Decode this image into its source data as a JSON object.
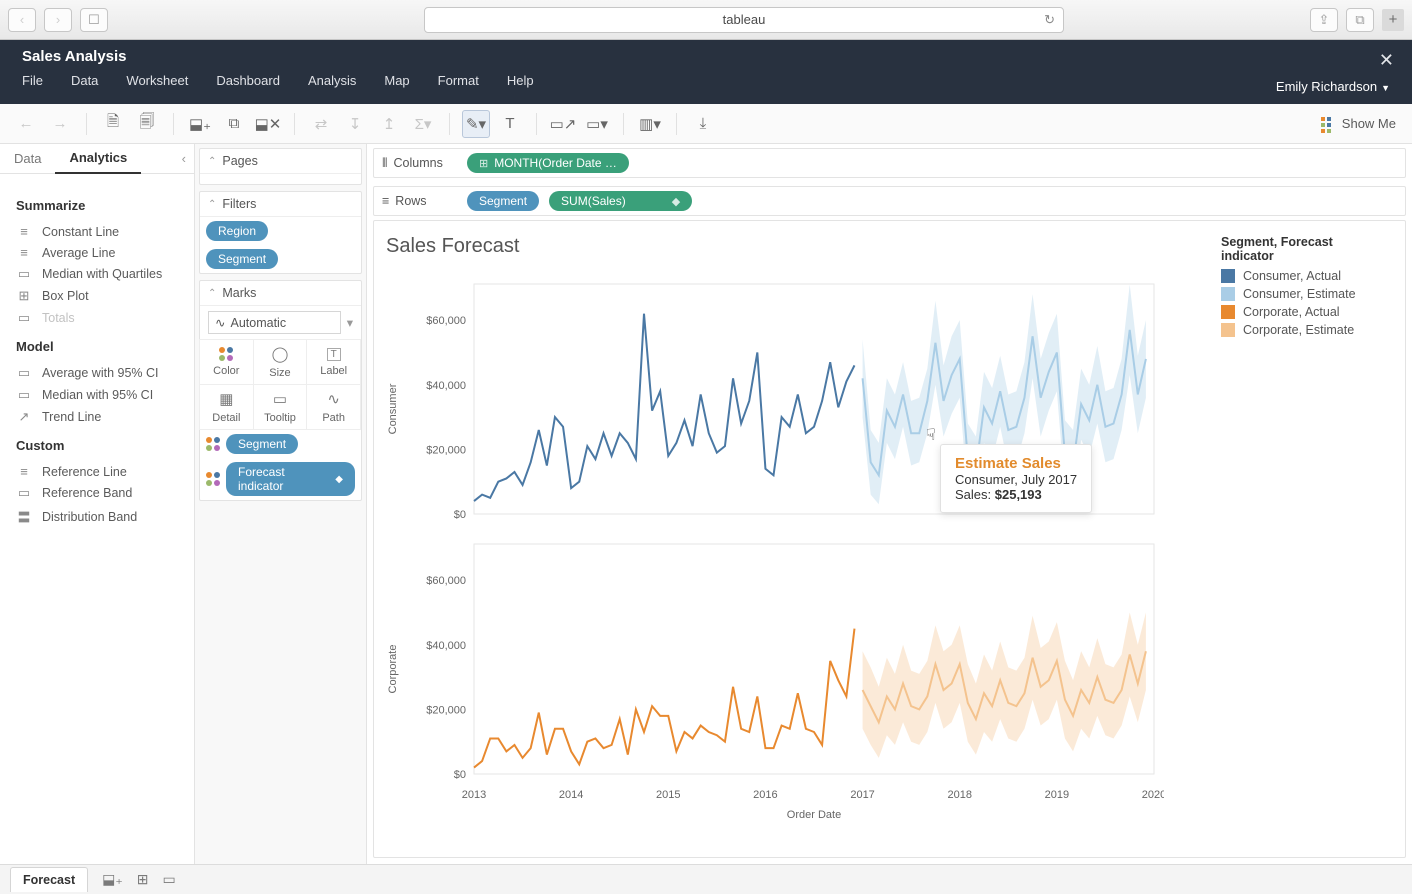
{
  "browser": {
    "url_label": "tableau"
  },
  "app": {
    "title": "Sales Analysis",
    "menus": [
      "File",
      "Data",
      "Worksheet",
      "Dashboard",
      "Analysis",
      "Map",
      "Format",
      "Help"
    ],
    "user": "Emily Richardson"
  },
  "toolbar": {
    "showme": "Show Me"
  },
  "left_panel": {
    "tabs": [
      "Data",
      "Analytics"
    ],
    "active_tab": "Analytics",
    "sections": {
      "summarize": {
        "title": "Summarize",
        "items": [
          "Constant Line",
          "Average Line",
          "Median with Quartiles",
          "Box Plot",
          "Totals"
        ],
        "disabled": [
          "Totals"
        ]
      },
      "model": {
        "title": "Model",
        "items": [
          "Average with 95% CI",
          "Median with 95% CI",
          "Trend Line"
        ]
      },
      "custom": {
        "title": "Custom",
        "items": [
          "Reference Line",
          "Reference Band",
          "Distribution Band"
        ]
      }
    }
  },
  "cards": {
    "pages": "Pages",
    "filters": {
      "title": "Filters",
      "pills": [
        "Region",
        "Segment"
      ]
    },
    "marks": {
      "title": "Marks",
      "type": "Automatic",
      "cells": [
        "Color",
        "Size",
        "Label",
        "Detail",
        "Tooltip",
        "Path"
      ],
      "encodings": [
        {
          "label": "Segment",
          "icon": "color"
        },
        {
          "label": "Forecast indicator",
          "icon": "color",
          "badge": true
        }
      ]
    }
  },
  "shelves": {
    "columns": {
      "label": "Columns",
      "chips": [
        {
          "text": "MONTH(Order Date …",
          "kind": "green"
        }
      ]
    },
    "rows": {
      "label": "Rows",
      "chips": [
        {
          "text": "Segment",
          "kind": "blue"
        },
        {
          "text": "SUM(Sales)",
          "kind": "green",
          "badge": true
        }
      ]
    }
  },
  "viz": {
    "title": "Sales Forecast",
    "x_label": "Order Date",
    "rows": [
      "Consumer",
      "Corporate"
    ],
    "y_ticks": [
      "$0",
      "$20,000",
      "$40,000",
      "$60,000"
    ],
    "x_ticks": [
      "2013",
      "2014",
      "2015",
      "2016",
      "2017",
      "2018",
      "2019",
      "2020"
    ],
    "legend": {
      "title": "Segment, Forecast indicator",
      "items": [
        {
          "label": "Consumer, Actual",
          "color": "#4a78a4"
        },
        {
          "label": "Consumer, Estimate",
          "color": "#a9cde6"
        },
        {
          "label": "Corporate, Actual",
          "color": "#e8892f"
        },
        {
          "label": "Corporate, Estimate",
          "color": "#f4c38e"
        }
      ]
    },
    "tooltip": {
      "title": "Estimate Sales",
      "line2": "Consumer, July 2017",
      "line3_label": "Sales: ",
      "line3_value": "$25,193"
    }
  },
  "bottom": {
    "sheet": "Forecast"
  },
  "chart_data": [
    {
      "type": "line",
      "title": "Sales Forecast",
      "panel": "Consumer",
      "xlabel": "Order Date",
      "ylabel": "Consumer",
      "ylim": [
        0,
        65000
      ],
      "x_years": [
        2013,
        2014,
        2015,
        2016,
        2017,
        2018,
        2019,
        2020
      ],
      "series": [
        {
          "name": "Consumer, Actual",
          "color": "#4a78a4",
          "x_months": [
            0,
            1,
            2,
            3,
            4,
            5,
            6,
            7,
            8,
            9,
            10,
            11,
            12,
            13,
            14,
            15,
            16,
            17,
            18,
            19,
            20,
            21,
            22,
            23,
            24,
            25,
            26,
            27,
            28,
            29,
            30,
            31,
            32,
            33,
            34,
            35,
            36,
            37,
            38,
            39,
            40,
            41,
            42,
            43,
            44,
            45,
            46,
            47
          ],
          "values": [
            4000,
            6000,
            5000,
            10000,
            11000,
            13000,
            9000,
            16000,
            26000,
            15000,
            30000,
            27000,
            8000,
            10000,
            21000,
            17000,
            25000,
            18000,
            25000,
            22000,
            17000,
            62000,
            32000,
            38000,
            18000,
            22000,
            29000,
            21000,
            37000,
            25000,
            19000,
            21000,
            42000,
            28000,
            35000,
            50000,
            14000,
            12000,
            30000,
            27000,
            37000,
            25000,
            27000,
            35000,
            47000,
            33000,
            41000,
            46000
          ]
        },
        {
          "name": "Consumer, Estimate",
          "color": "#a9cde6",
          "x_months": [
            48,
            49,
            50,
            51,
            52,
            53,
            54,
            55,
            56,
            57,
            58,
            59,
            60,
            61,
            62,
            63,
            64,
            65,
            66,
            67,
            68,
            69,
            70,
            71,
            72,
            73,
            74,
            75,
            76,
            77,
            78,
            79,
            80,
            81,
            82,
            83
          ],
          "values": [
            42000,
            16000,
            12000,
            32000,
            27000,
            37000,
            25000,
            25000,
            35000,
            53000,
            35000,
            43000,
            48000,
            17000,
            14000,
            33000,
            28000,
            38000,
            26000,
            27000,
            36000,
            55000,
            36000,
            44000,
            50000,
            18000,
            15000,
            34000,
            29000,
            40000,
            27000,
            28000,
            37000,
            57000,
            37000,
            48000
          ],
          "band_low": [
            30000,
            6000,
            3000,
            22000,
            17000,
            27000,
            15000,
            16000,
            25000,
            40000,
            24000,
            31000,
            36000,
            6000,
            4000,
            22000,
            17000,
            27000,
            15000,
            16000,
            25000,
            42000,
            24000,
            32000,
            38000,
            7000,
            4000,
            23000,
            18000,
            28000,
            16000,
            17000,
            26000,
            43000,
            25000,
            36000
          ],
          "band_high": [
            54000,
            26000,
            22000,
            42000,
            37000,
            47000,
            35000,
            36000,
            45000,
            66000,
            46000,
            55000,
            60000,
            28000,
            24000,
            44000,
            39000,
            49000,
            37000,
            38000,
            47000,
            68000,
            48000,
            56000,
            62000,
            29000,
            26000,
            45000,
            40000,
            52000,
            38000,
            39000,
            48000,
            71000,
            49000,
            60000
          ]
        }
      ]
    },
    {
      "type": "line",
      "title": "Sales Forecast",
      "panel": "Corporate",
      "xlabel": "Order Date",
      "ylabel": "Corporate",
      "ylim": [
        0,
        65000
      ],
      "x_years": [
        2013,
        2014,
        2015,
        2016,
        2017,
        2018,
        2019,
        2020
      ],
      "series": [
        {
          "name": "Corporate, Actual",
          "color": "#e8892f",
          "x_months": [
            0,
            1,
            2,
            3,
            4,
            5,
            6,
            7,
            8,
            9,
            10,
            11,
            12,
            13,
            14,
            15,
            16,
            17,
            18,
            19,
            20,
            21,
            22,
            23,
            24,
            25,
            26,
            27,
            28,
            29,
            30,
            31,
            32,
            33,
            34,
            35,
            36,
            37,
            38,
            39,
            40,
            41,
            42,
            43,
            44,
            45,
            46,
            47
          ],
          "values": [
            2000,
            4000,
            11000,
            11000,
            7000,
            9000,
            5000,
            8000,
            19000,
            6000,
            14000,
            14000,
            7000,
            3000,
            10000,
            11000,
            8000,
            9000,
            17000,
            6000,
            20000,
            13000,
            21000,
            18000,
            18000,
            7000,
            13000,
            11000,
            15000,
            13000,
            12000,
            10000,
            27000,
            14000,
            13000,
            24000,
            8000,
            8000,
            15000,
            14000,
            25000,
            14000,
            13000,
            9000,
            35000,
            29000,
            24000,
            45000
          ]
        },
        {
          "name": "Corporate, Estimate",
          "color": "#f4c38e",
          "x_months": [
            48,
            49,
            50,
            51,
            52,
            53,
            54,
            55,
            56,
            57,
            58,
            59,
            60,
            61,
            62,
            63,
            64,
            65,
            66,
            67,
            68,
            69,
            70,
            71,
            72,
            73,
            74,
            75,
            76,
            77,
            78,
            79,
            80,
            81,
            82,
            83
          ],
          "values": [
            26000,
            21000,
            16000,
            24000,
            20000,
            28000,
            21000,
            20000,
            24000,
            34000,
            26000,
            28000,
            34000,
            22000,
            17000,
            25000,
            21000,
            29000,
            22000,
            21000,
            25000,
            36000,
            27000,
            29000,
            35000,
            23000,
            18000,
            26000,
            22000,
            30000,
            23000,
            22000,
            26000,
            37000,
            28000,
            38000
          ],
          "band_low": [
            14000,
            9000,
            5000,
            12000,
            9000,
            16000,
            10000,
            9000,
            13000,
            22000,
            14000,
            16000,
            22000,
            10000,
            6000,
            13000,
            10000,
            17000,
            11000,
            10000,
            14000,
            23000,
            15000,
            17000,
            23000,
            11000,
            7000,
            14000,
            11000,
            18000,
            12000,
            11000,
            15000,
            24000,
            16000,
            26000
          ],
          "band_high": [
            38000,
            33000,
            27000,
            36000,
            31000,
            40000,
            32000,
            31000,
            35000,
            46000,
            38000,
            40000,
            46000,
            34000,
            28000,
            37000,
            32000,
            41000,
            33000,
            32000,
            36000,
            49000,
            39000,
            41000,
            47000,
            35000,
            29000,
            38000,
            33000,
            42000,
            34000,
            33000,
            37000,
            50000,
            40000,
            50000
          ]
        }
      ]
    }
  ]
}
